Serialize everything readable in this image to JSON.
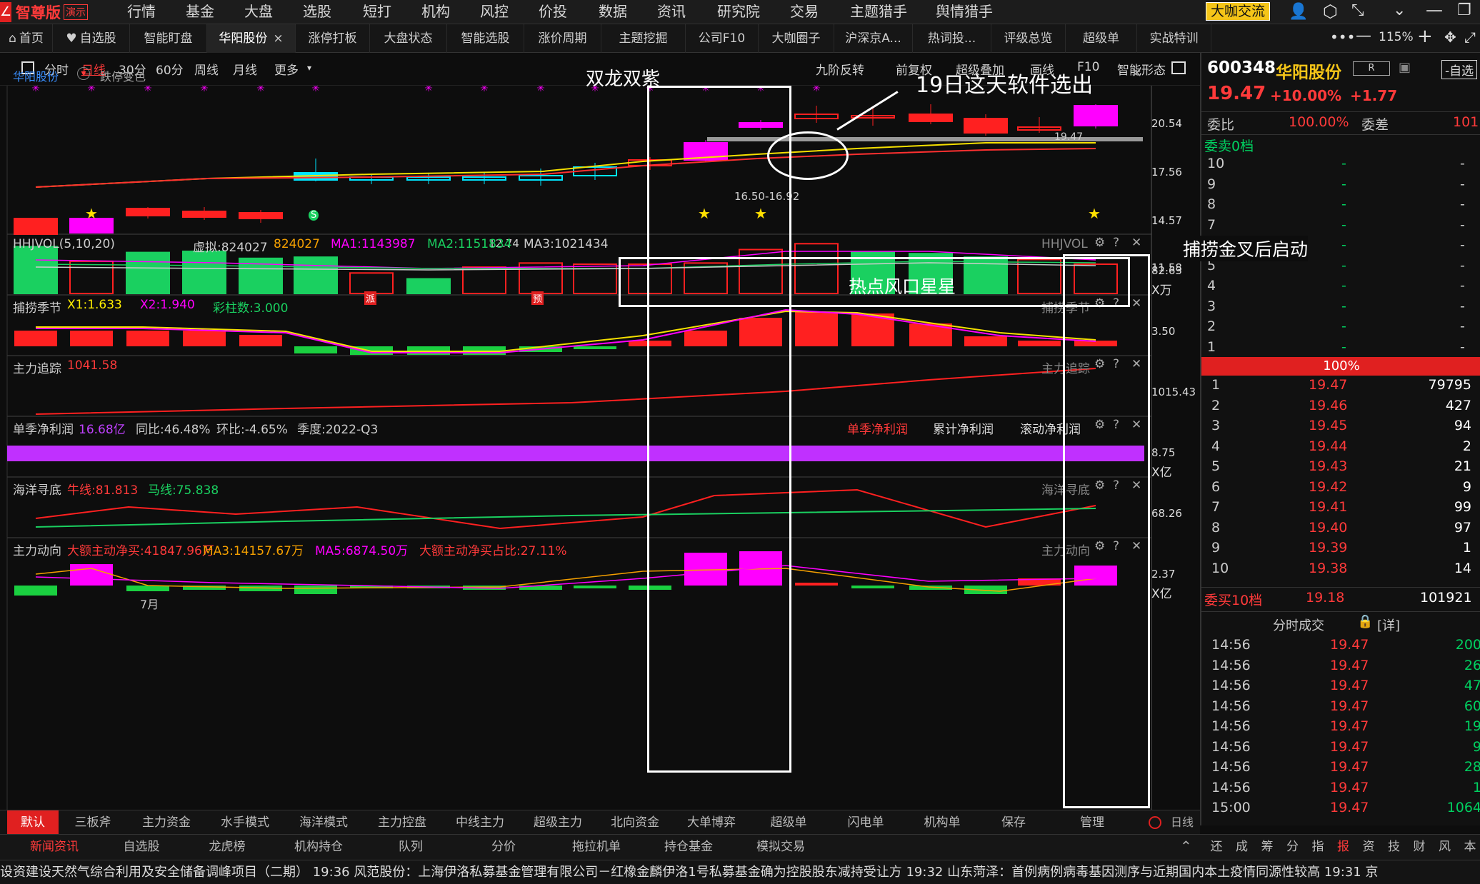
{
  "app": {
    "logo_text": "智尊版",
    "demo_badge": "演示",
    "consult_btn": "大咖交流",
    "zoom": "115%"
  },
  "menu": [
    "行情",
    "基金",
    "大盘",
    "选股",
    "短打",
    "机构",
    "风控",
    "价投",
    "数据",
    "资讯",
    "研究院",
    "交易",
    "主题猎手",
    "舆情猎手"
  ],
  "tabs": [
    "首页",
    "自选股",
    "智能盯盘",
    "华阳股份",
    "涨停打板",
    "大盘状态",
    "智能选股",
    "涨价周期",
    "主题挖掘",
    "公司F10",
    "大咖圈子",
    "沪深京A...",
    "热词投...",
    "评级总览",
    "超级单",
    "实战特训"
  ],
  "chart_toolbar": {
    "left": [
      "分时",
      "日线",
      "30分",
      "60分",
      "周线",
      "月线",
      "更多"
    ],
    "right": [
      "九阶反转",
      "前复权",
      "超级叠加",
      "画线",
      "F10",
      "智能形态"
    ]
  },
  "stock": {
    "code": "600348",
    "name": "华阳股份",
    "price": "19.47",
    "pct": "+10.00%",
    "chg": "+1.77",
    "tag": "R",
    "select_btn": "-自选"
  },
  "main_chart": {
    "label": "华阳股份",
    "option": "跌停变色",
    "price_levels": [
      "20.54",
      "17.56",
      "14.57",
      "11.58"
    ],
    "price_note_high": "19.47",
    "price_note_range": "16.50-16.92",
    "price_note_low": "12.74",
    "signals": [
      "派",
      "预",
      "S"
    ]
  },
  "annotations": {
    "title1": "双龙双紫",
    "title2": "19日这天软件选出",
    "title3": "热点风口星星",
    "title4": "捕捞金叉后启动"
  },
  "panels": [
    {
      "name": "HHJVOL(5,10,20)",
      "items": [
        "虚拟:824027",
        "824027",
        "MA1:1143987",
        "MA2:1151834",
        "MA3:1021434"
      ],
      "right": "HHJVOL",
      "axis": "82.63",
      "unit": "X万"
    },
    {
      "name": "捕捞季节",
      "items": [
        "X1:1.633",
        "X2:1.940",
        "彩柱数:3.000"
      ],
      "right": "捕捞季节",
      "axis": "3.50"
    },
    {
      "name": "主力追踪",
      "items": [
        "1041.58"
      ],
      "right": "主力追踪",
      "axis": "1015.43"
    },
    {
      "name": "单季净利润",
      "items": [
        "16.68亿",
        "同比:46.48%",
        "环比:-4.65%",
        "季度:2022-Q3"
      ],
      "right_tabs": [
        "单季净利润",
        "累计净利润",
        "滚动净利润"
      ],
      "axis": "8.75",
      "unit": "X亿"
    },
    {
      "name": "海洋寻底",
      "items": [
        "牛线:81.813",
        "马线:75.838"
      ],
      "right": "海洋寻底",
      "axis": "68.26"
    },
    {
      "name": "主力动向",
      "items": [
        "大额主动净买:41847.96万",
        "MA3:14157.67万",
        "MA5:6874.50万",
        "大额主动净买占比:27.11%"
      ],
      "right": "主力动向",
      "axis": "2.37",
      "unit": "X亿",
      "xlabel": "7月"
    }
  ],
  "order_book": {
    "wei_bi_label": "委比",
    "wei_bi": "100.00%",
    "wei_cha_label": "委差",
    "wei_cha": "101",
    "sell_header": "委卖0档",
    "sell_rows": [
      "10",
      "9",
      "8",
      "7",
      "6",
      "5",
      "4",
      "3",
      "2",
      "1"
    ],
    "pct_bar": "100%",
    "buy_rows": [
      [
        "1",
        "19.47",
        "79795"
      ],
      [
        "2",
        "19.46",
        "427"
      ],
      [
        "3",
        "19.45",
        "94"
      ],
      [
        "4",
        "19.44",
        "2"
      ],
      [
        "5",
        "19.43",
        "21"
      ],
      [
        "6",
        "19.42",
        "9"
      ],
      [
        "7",
        "19.41",
        "99"
      ],
      [
        "8",
        "19.40",
        "97"
      ],
      [
        "9",
        "19.39",
        "1"
      ],
      [
        "10",
        "19.38",
        "14"
      ]
    ],
    "buy_header": "委买10档",
    "buy_price": "19.18",
    "buy_vol": "101921"
  },
  "trades": {
    "title": "分时成交",
    "detail": "[详]",
    "rows": [
      [
        "14:56",
        "19.47",
        "200"
      ],
      [
        "14:56",
        "19.47",
        "26"
      ],
      [
        "14:56",
        "19.47",
        "47"
      ],
      [
        "14:56",
        "19.47",
        "60"
      ],
      [
        "14:56",
        "19.47",
        "19"
      ],
      [
        "14:56",
        "19.47",
        "9"
      ],
      [
        "14:56",
        "19.47",
        "28"
      ],
      [
        "14:56",
        "19.47",
        "1"
      ],
      [
        "15:00",
        "19.47",
        "1064"
      ]
    ]
  },
  "bottom_tabs": [
    "默认",
    "三板斧",
    "主力资金",
    "水手模式",
    "海洋模式",
    "主力控盘",
    "中线主力",
    "超级主力",
    "北向资金",
    "大单博弈",
    "超级单",
    "闪电单",
    "机构单",
    "保存",
    "管理"
  ],
  "period_label": "日线",
  "bottom_tabs2": [
    "新闻资讯",
    "自选股",
    "龙虎榜",
    "机构持仓",
    "队列",
    "分价",
    "拖拉机单",
    "持仓基金",
    "模拟交易"
  ],
  "right_tabs": [
    "还",
    "成",
    "筹",
    "分",
    "指",
    "报",
    "资",
    "技",
    "财",
    "风",
    "本"
  ],
  "ticker": "设资建设天然气综合利用及安全储备调峰项目（二期）   19:36 风范股份：上海伊洛私募基金管理有限公司－红橡金麟伊洛1号私募基金确为控股股东减持受让方   19:32 山东菏泽：首例病例病毒基因测序与近期国内本土疫情同源性较高   19:31 京"
}
